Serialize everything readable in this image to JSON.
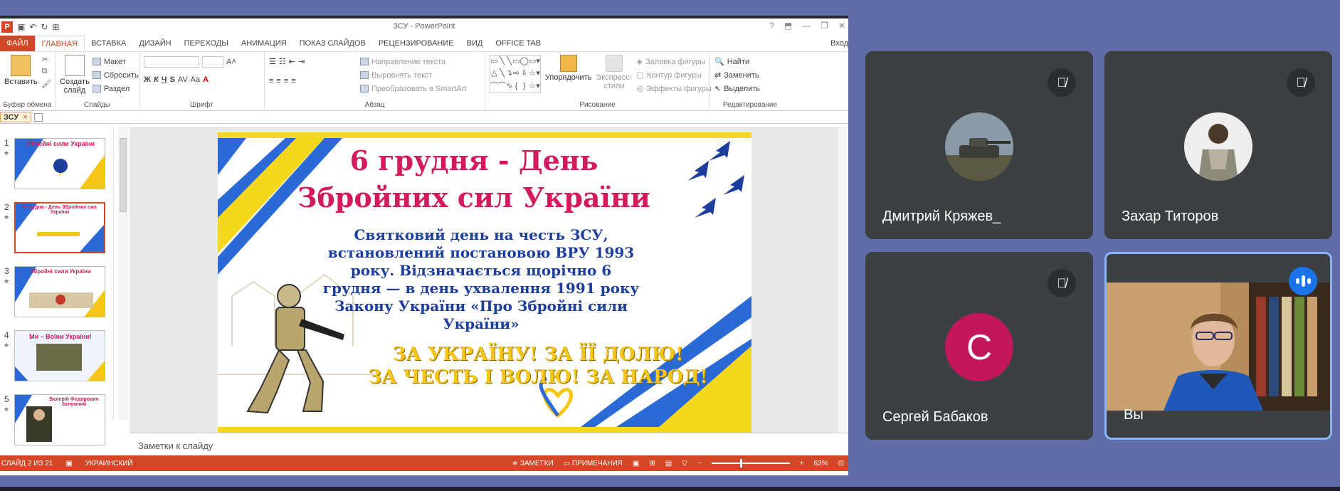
{
  "powerpoint": {
    "window_title": "ЗСУ - PowerPoint",
    "tabs": [
      "ФАЙЛ",
      "ГЛАВНАЯ",
      "ВСТАВКА",
      "ДИЗАЙН",
      "ПЕРЕХОДЫ",
      "АНИМАЦИЯ",
      "ПОКАЗ СЛАЙДОВ",
      "РЕЦЕНЗИРОВАНИЕ",
      "ВИД",
      "OFFICE TAB"
    ],
    "login_label": "Вход",
    "ribbon": {
      "clipboard": {
        "paste": "Вставить",
        "group": "Буфер обмена"
      },
      "slides": {
        "create": "Создать",
        "create2": "слайд",
        "layout": "Макет",
        "reset": "Сбросить",
        "section": "Раздел",
        "group": "Слайды"
      },
      "font": {
        "bold": "Ж",
        "italic": "К",
        "underline": "Ч",
        "strike": "S",
        "spacing": "AV",
        "case": "Aa",
        "group": "Шрифт"
      },
      "paragraph": {
        "text_direction": "Направление текста",
        "align_text": "Выровнять текст",
        "smartart": "Преобразовать в SmartArt",
        "group": "Абзац"
      },
      "drawing": {
        "arrange": "Упорядочить",
        "quick_styles": "Экспресс-",
        "quick_styles2": "стили",
        "fill": "Заливка фигуры",
        "outline": "Контур фигуры",
        "effects": "Эффекты фигуры",
        "group": "Рисование"
      },
      "editing": {
        "find": "Найти",
        "replace": "Заменить",
        "select": "Выделить",
        "group": "Редактирование"
      }
    },
    "doc_tab": "ЗСУ",
    "thumbnail_numbers": [
      "1",
      "2",
      "3",
      "4",
      "5"
    ],
    "thumbnail_texts": [
      "Збройні сили України",
      "6 грудня - День Збройних сил України",
      "Збройні сили України",
      "Ми – Воїни України!",
      "Валерій Федорович Залужний"
    ],
    "slide": {
      "title_line1": "6 грудня  - День",
      "title_line2": "Збройних сил України",
      "body_lines": [
        "Святковий день на честь ЗСУ,",
        "встановлений постановою ВРУ 1993",
        "року. Відзначається щорічно 6",
        "грудня — в день ухвалення 1991 року",
        "Закону України «Про Збройні сили",
        "України»"
      ],
      "slogan_line1": "ЗА УКРАЇНУ! ЗА ЇЇ ДОЛЮ!",
      "slogan_line2": "ЗА ЧЕСТЬ І ВОЛЮ! ЗА НАРОД!"
    },
    "notes_placeholder": "Заметки к слайду",
    "status": {
      "slide_counter": "СЛАЙД 2 ИЗ 21",
      "language": "УКРАИНСКИЙ",
      "notes": "ЗАМЕТКИ",
      "comments": "ПРИМЕЧАНИЯ",
      "zoom": "63%"
    }
  },
  "meeting": {
    "participants": [
      {
        "name": "Дмитрий Кряжев_",
        "muted": true
      },
      {
        "name": "Захар Титоров",
        "muted": true
      },
      {
        "name": "Сергей Бабаков",
        "muted": true,
        "initial": "С"
      },
      {
        "name": "Вы",
        "speaking": true
      }
    ],
    "colors": {
      "tile_bg": "#3c4043",
      "avatar_c": "#c2185b",
      "accent": "#1a73e8",
      "self_border": "#8ab4f8"
    }
  }
}
